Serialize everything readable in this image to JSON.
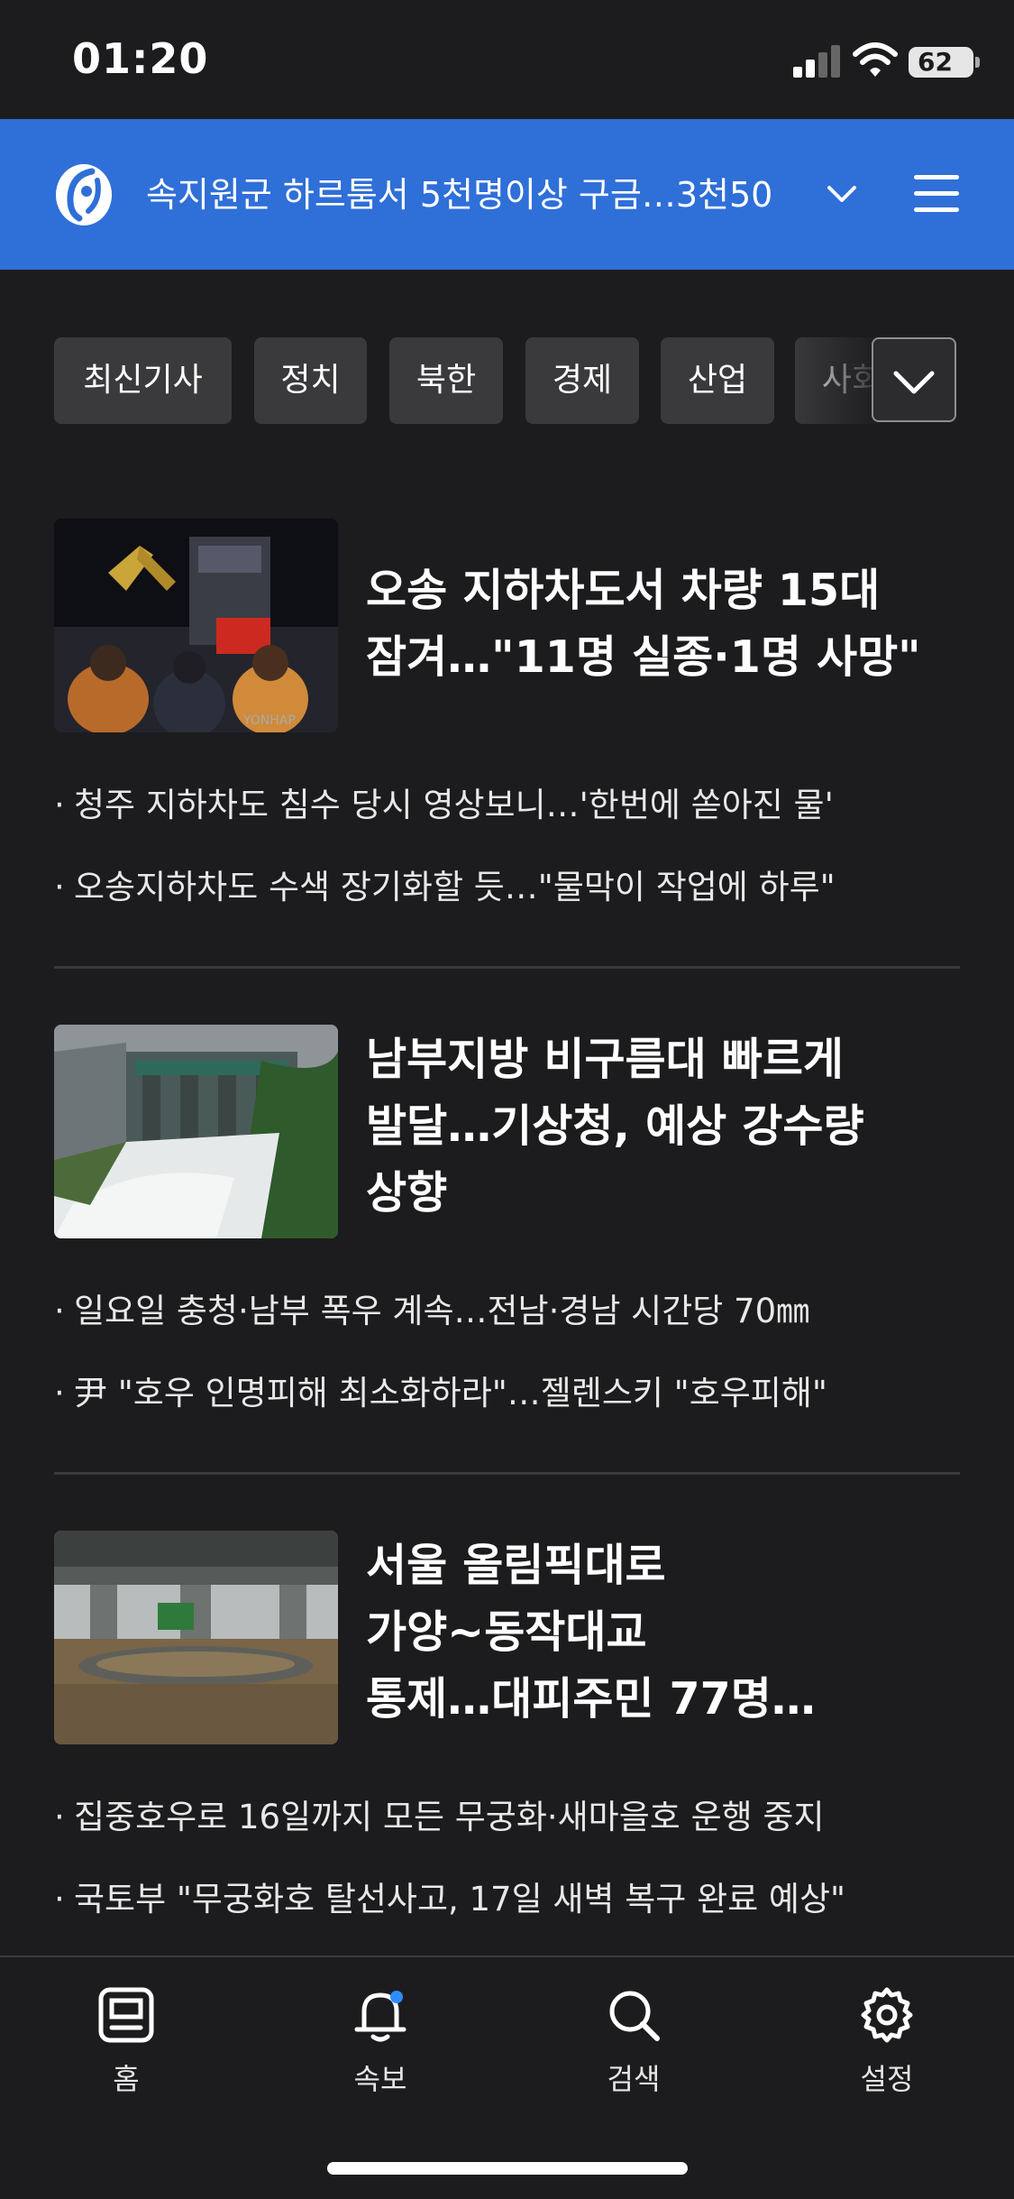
{
  "status": {
    "time": "01:20",
    "battery": "62"
  },
  "header": {
    "ticker": "속지원군 하르툼서 5천명이상 구금…3천50",
    "logo_icon": "yonhap-logo",
    "menu_icon": "hamburger-menu-icon",
    "colors": {
      "bar": "#2f6fd8",
      "background": "#1c1c1e"
    }
  },
  "categories": [
    "최신기사",
    "정치",
    "북한",
    "경제",
    "산업",
    "사회"
  ],
  "articles": [
    {
      "title_line1": "오송 지하차도서 차량 15대",
      "title_line2": "잠겨…\"11명 실종·1명 사망\"",
      "title_line3": "",
      "subs": [
        "청주 지하차도 침수 당시 영상보니…'한번에 쏟아진 물'",
        "오송지하차도 수색 장기화할 듯…\"물막이 작업에 하루\""
      ]
    },
    {
      "title_line1": "남부지방 비구름대 빠르게",
      "title_line2": "발달…기상청, 예상 강수량",
      "title_line3": "상향",
      "subs": [
        "일요일 충청·남부 폭우 계속…전남·경남 시간당 70㎜",
        "尹 \"호우 인명피해 최소화하라\"…젤렌스키 \"호우피해\""
      ]
    },
    {
      "title_line1": "서울 올림픽대로",
      "title_line2": "가양~동작대교",
      "title_line3": "통제…대피주민 77명…",
      "subs": [
        "집중호우로 16일까지 모든 무궁화·새마을호 운행 중지",
        "국토부 \"무궁화호 탈선사고, 17일 새벽 복구 완료 예상\""
      ]
    }
  ],
  "tabs": [
    {
      "label": "홈",
      "icon": "home-icon"
    },
    {
      "label": "속보",
      "icon": "bell-icon"
    },
    {
      "label": "검색",
      "icon": "search-icon"
    },
    {
      "label": "설정",
      "icon": "gear-icon"
    }
  ]
}
